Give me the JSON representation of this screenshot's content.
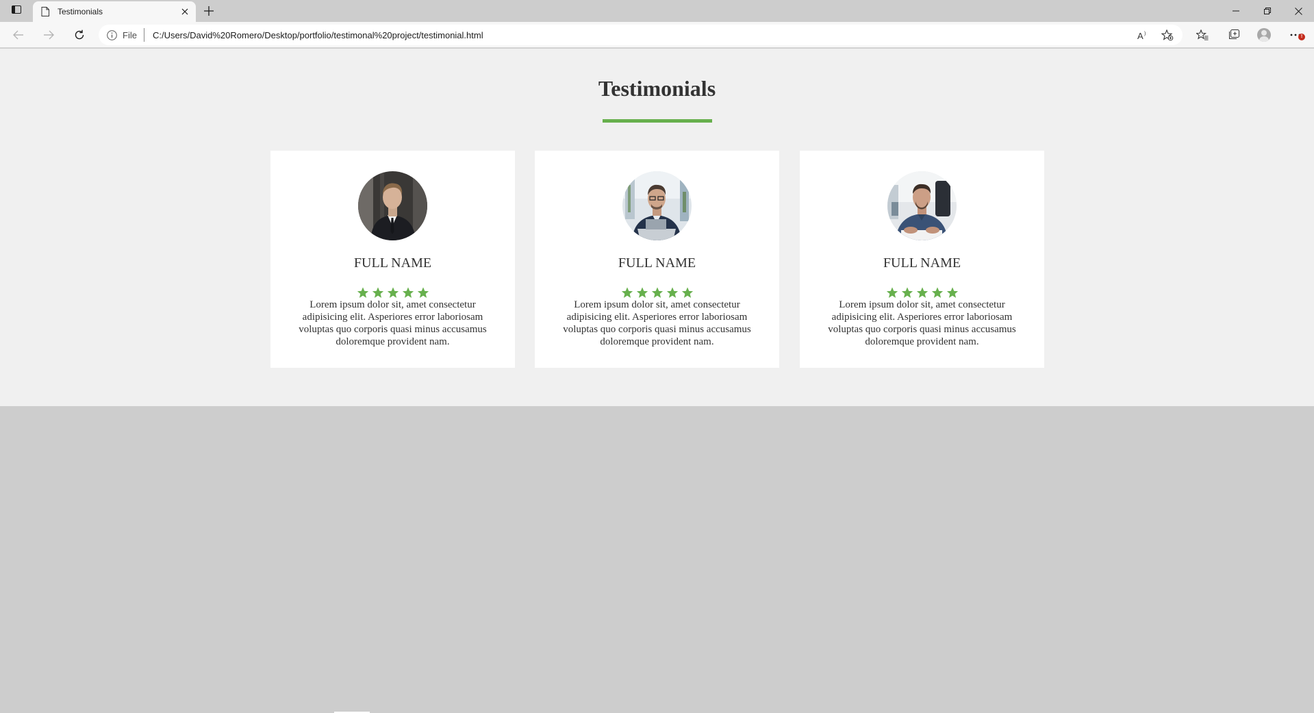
{
  "browser": {
    "tab": {
      "title": "Testimonials",
      "favicon": "page-icon",
      "close_icon": "close-icon"
    },
    "new_tab_icon": "plus-icon",
    "window_controls": [
      "minimize-icon",
      "restore-icon",
      "close-icon"
    ],
    "address_bar": {
      "site_info_label": "File",
      "site_info_icon": "info-icon",
      "url": "C:/Users/David%20Romero/Desktop/portfolio/testimonal%20project/testimonial.html",
      "read_aloud_icon": "read-aloud-icon",
      "favorite_icon": "add-favorite-icon"
    },
    "toolbar_icons": [
      "back-icon",
      "forward-icon",
      "reload-icon",
      "favorites-icon",
      "collections-icon",
      "profile-icon",
      "more-icon"
    ],
    "notification_badge": "!"
  },
  "page": {
    "heading": "Testimonials",
    "accent_color": "#67b04d",
    "background_color": "#f0f0f0",
    "card_color": "#ffffff",
    "cards": [
      {
        "name": "FULL NAME",
        "rating": 5,
        "text": "Lorem ipsum dolor sit, amet consectetur adipisicing elit. Asperiores error laboriosam voluptas quo corporis quasi minus accusamus doloremque provident nam.",
        "photo": "man-in-suit-portrait"
      },
      {
        "name": "FULL NAME",
        "rating": 5,
        "text": "Lorem ipsum dolor sit, amet consectetur adipisicing elit. Asperiores error laboriosam voluptas quo corporis quasi minus accusamus doloremque provident nam.",
        "photo": "man-at-laptop-portrait"
      },
      {
        "name": "FULL NAME",
        "rating": 5,
        "text": "Lorem ipsum dolor sit, amet consectetur adipisicing elit. Asperiores error laboriosam voluptas quo corporis quasi minus accusamus doloremque provident nam.",
        "photo": "man-in-office-portrait"
      }
    ]
  }
}
